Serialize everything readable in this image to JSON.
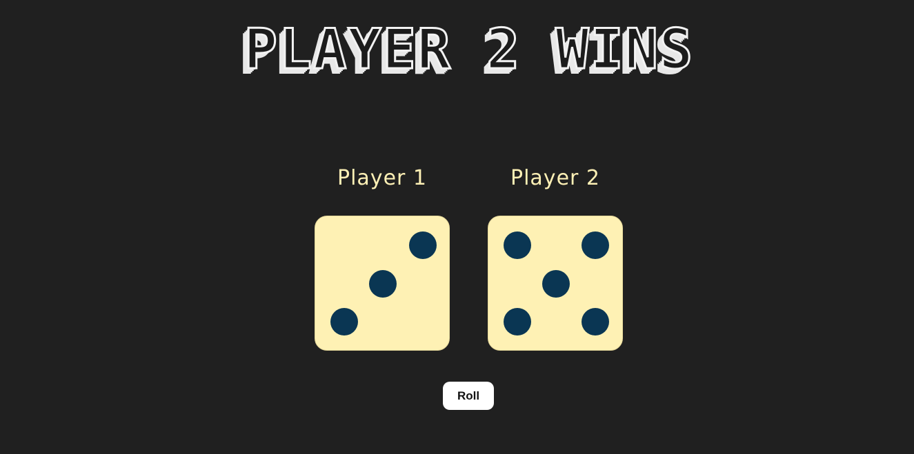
{
  "title": "PLAYER 2 WINS",
  "players": [
    {
      "label": "Player 1",
      "die_value": 3
    },
    {
      "label": "Player 2",
      "die_value": 5
    }
  ],
  "roll_button_label": "Roll",
  "colors": {
    "background": "#202020",
    "die_face": "#fef1b4",
    "pip": "#0a3653",
    "player_label": "#fdf0b5",
    "title_fill": "#1c1c1c",
    "title_outline": "#f2f2f2"
  }
}
